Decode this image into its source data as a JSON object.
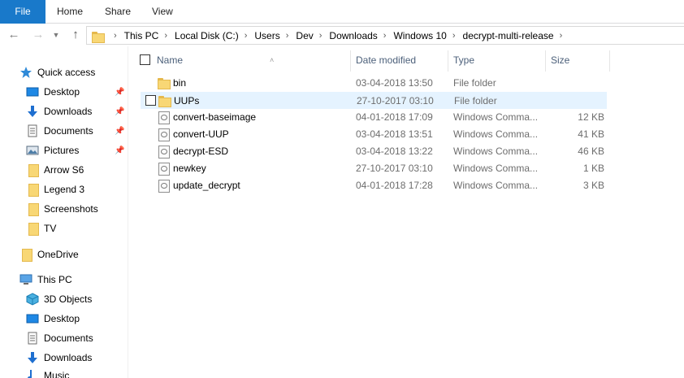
{
  "ribbon": {
    "tabs": [
      "File",
      "Home",
      "Share",
      "View"
    ],
    "colors": {
      "file_tab_bg": "#1979ca",
      "selected_row": "#e5f3ff"
    }
  },
  "address": {
    "crumbs": [
      "This PC",
      "Local Disk (C:)",
      "Users",
      "Dev",
      "Downloads",
      "Windows 10",
      "decrypt-multi-release"
    ]
  },
  "sidebar": {
    "quick_access": "Quick access",
    "pinned": [
      {
        "label": "Desktop",
        "icon": "desktop-icon"
      },
      {
        "label": "Downloads",
        "icon": "download-arrow-icon"
      },
      {
        "label": "Documents",
        "icon": "document-icon"
      },
      {
        "label": "Pictures",
        "icon": "pictures-icon"
      }
    ],
    "folders": [
      "Arrow S6",
      "Legend 3",
      "Screenshots",
      "TV"
    ],
    "onedrive": "OneDrive",
    "this_pc": "This PC",
    "this_pc_items": [
      {
        "label": "3D Objects",
        "icon": "3d-objects-icon"
      },
      {
        "label": "Desktop",
        "icon": "desktop-icon"
      },
      {
        "label": "Documents",
        "icon": "document-icon"
      },
      {
        "label": "Downloads",
        "icon": "download-arrow-icon"
      },
      {
        "label": "Music",
        "icon": "music-icon"
      }
    ]
  },
  "list": {
    "headers": {
      "name": "Name",
      "date": "Date modified",
      "type": "Type",
      "size": "Size"
    },
    "rows": [
      {
        "name": "bin",
        "date": "03-04-2018 13:50",
        "type": "File folder",
        "size": "",
        "icon": "folder-icon"
      },
      {
        "name": "UUPs",
        "date": "27-10-2017 03:10",
        "type": "File folder",
        "size": "",
        "icon": "folder-icon",
        "selected": true
      },
      {
        "name": "convert-baseimage",
        "date": "04-01-2018 17:09",
        "type": "Windows Comma...",
        "size": "12 KB",
        "icon": "cmd-file-icon"
      },
      {
        "name": "convert-UUP",
        "date": "03-04-2018 13:51",
        "type": "Windows Comma...",
        "size": "41 KB",
        "icon": "cmd-file-icon"
      },
      {
        "name": "decrypt-ESD",
        "date": "03-04-2018 13:22",
        "type": "Windows Comma...",
        "size": "46 KB",
        "icon": "cmd-file-icon"
      },
      {
        "name": "newkey",
        "date": "27-10-2017 03:10",
        "type": "Windows Comma...",
        "size": "1 KB",
        "icon": "cmd-file-icon"
      },
      {
        "name": "update_decrypt",
        "date": "04-01-2018 17:28",
        "type": "Windows Comma...",
        "size": "3 KB",
        "icon": "cmd-file-icon"
      }
    ]
  }
}
